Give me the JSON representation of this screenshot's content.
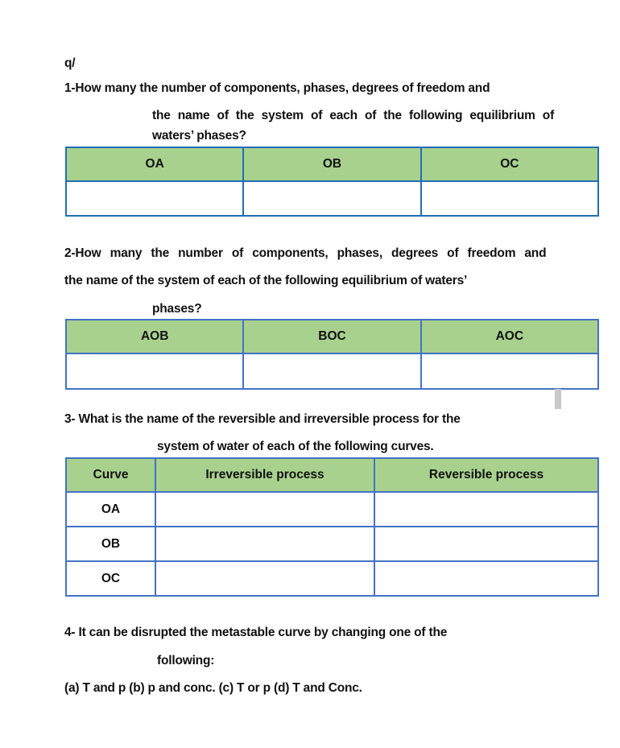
{
  "heading": "q/",
  "q1": {
    "line1": "1-How many the number of components, phases, degrees of freedom and",
    "line2": "the name of the system of each of the following equilibrium of",
    "line3": "waters’ phases?",
    "table": {
      "headers": [
        "OA",
        "OB",
        "OC"
      ],
      "rows": [
        [
          "",
          "",
          ""
        ]
      ]
    }
  },
  "q2": {
    "line1": "2-How many the number of components, phases, degrees of freedom and",
    "line2": "the name of the system of each of the following equilibrium of waters’",
    "line3": "phases?",
    "table": {
      "headers": [
        "AOB",
        "BOC",
        "AOC"
      ],
      "rows": [
        [
          "",
          "",
          ""
        ]
      ]
    }
  },
  "q3": {
    "line1": "3- What is the name of the reversible and irreversible process for the",
    "line2": "system of water of each of the following curves.",
    "table": {
      "headers": [
        "Curve",
        "Irreversible process",
        "Reversible process"
      ],
      "rows": [
        [
          "OA",
          "",
          ""
        ],
        [
          "OB",
          "",
          ""
        ],
        [
          "OC",
          "",
          ""
        ]
      ]
    }
  },
  "q4": {
    "line1": "4- It can be disrupted the metastable curve by changing one of the",
    "line2": "following:",
    "options": "(a) T and p (b) p and conc. (c) T or p (d) T and Conc."
  }
}
